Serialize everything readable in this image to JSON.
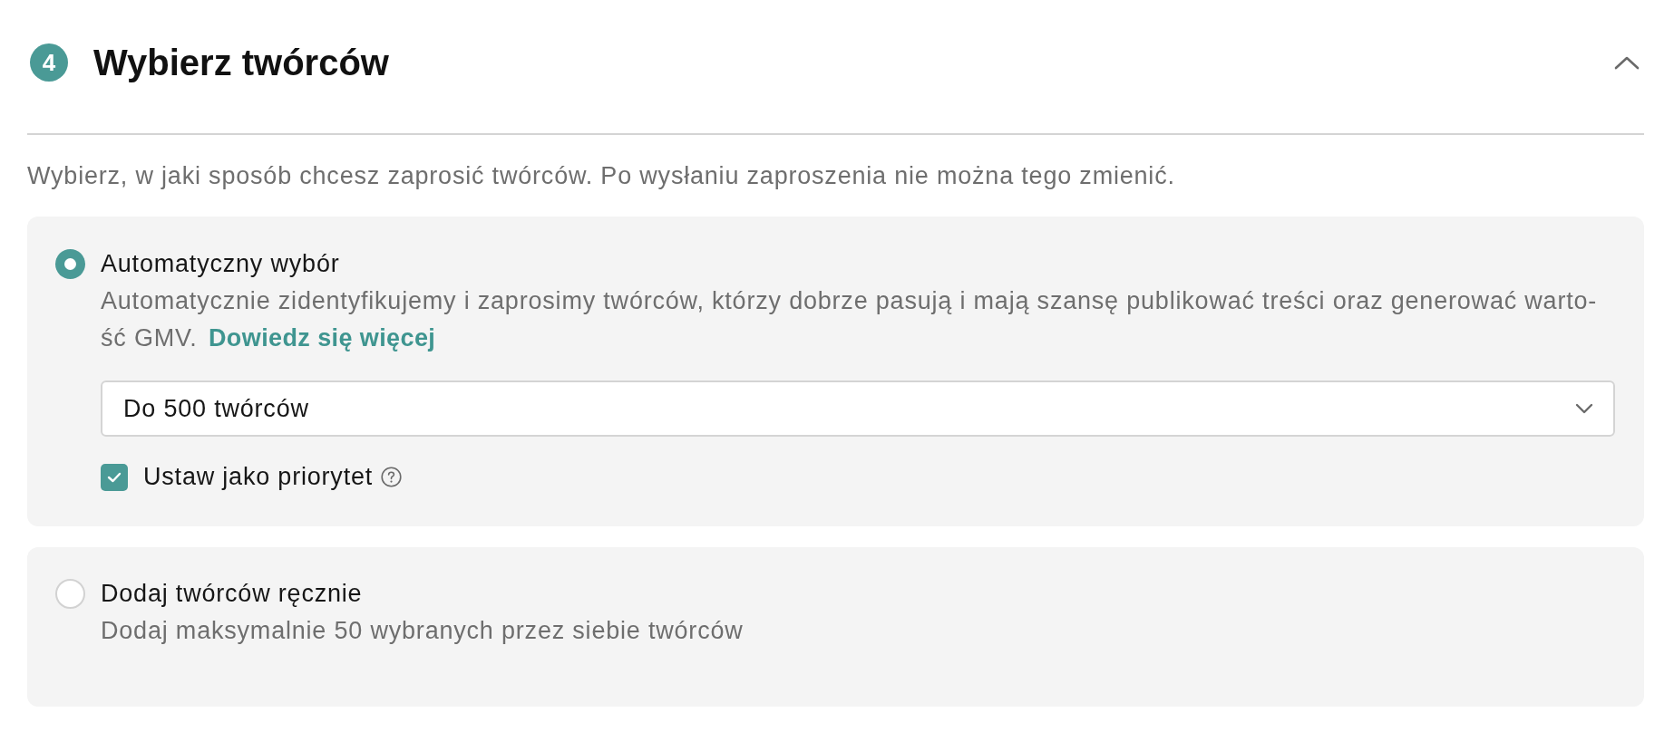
{
  "section": {
    "step_number": "4",
    "title": "Wybierz twórców",
    "expanded": true
  },
  "description": "Wybierz, w jaki sposób chcesz zaprosić twórców. Po wysłaniu zaproszenia nie można tego zmienić.",
  "options": [
    {
      "kind": "automatic",
      "title": "Automatyczny wybór",
      "selected": true,
      "description": "Automatycznie zidentyfikujemy i zaprosimy twórców, którzy dobrze pasują i mają szansę publikować treści oraz generować warto-ść GMV.",
      "link": "Dowiedz się więcej",
      "dropdown": {
        "value": "Do 500 twórców"
      },
      "priority": {
        "label": "Ustaw jako priorytet",
        "checked": true
      }
    },
    {
      "kind": "manual",
      "title": "Dodaj twórców ręcznie",
      "selected": false,
      "description": "Dodaj maksymalnie 50 wybranych przez siebie twórców"
    }
  ]
}
